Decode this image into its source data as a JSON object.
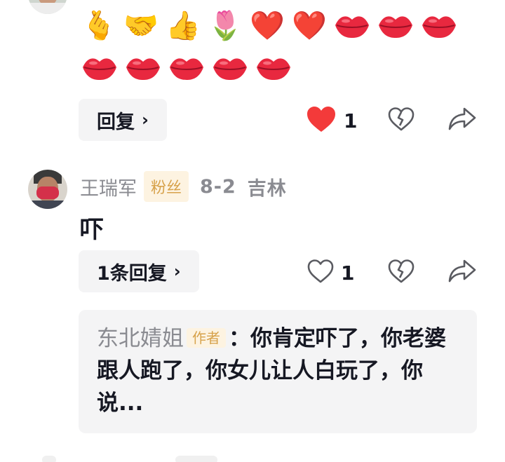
{
  "comment1": {
    "emojis": [
      "🫰",
      "🤝",
      "👍",
      "🌷",
      "❤️",
      "❤️"
    ],
    "lips_count_row1": 3,
    "lips_count_row2": 5,
    "reply_button": {
      "label": "回复",
      "chevron": "›"
    },
    "like": {
      "count": "1",
      "liked": true,
      "icon": "heart-icon"
    },
    "dislike_icon": "broken-heart-icon",
    "share_icon": "share-icon"
  },
  "comment2": {
    "username": "王瑞军",
    "fan_badge": "粉丝",
    "date": "8-2",
    "location": "吉林",
    "text": "吓",
    "reply_button": {
      "label": "1条回复",
      "chevron": "›"
    },
    "like": {
      "count": "1",
      "liked": false,
      "icon": "heart-icon"
    },
    "dislike_icon": "broken-heart-icon",
    "share_icon": "share-icon",
    "reply": {
      "author": "东北婧姐",
      "author_badge": "作者",
      "text": "：你肯定吓了，你老婆跟人跑了，你女儿让人白玩了，你说..."
    }
  },
  "colors": {
    "accent_red": "#fe2c55",
    "liked_heart": "#f33a3a",
    "muted_text": "#8a8b91",
    "badge_bg": "#fdf3e1",
    "badge_text": "#d7a24b",
    "button_bg": "#f4f4f5"
  }
}
